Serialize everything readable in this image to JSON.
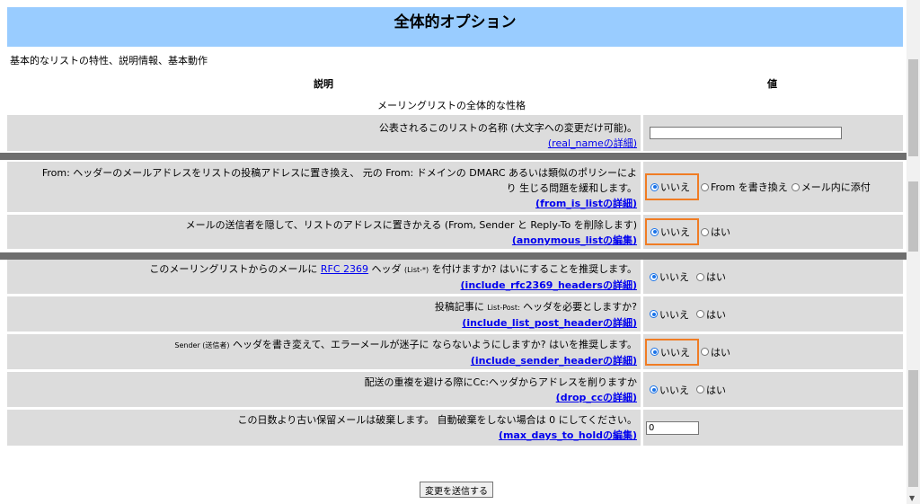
{
  "header": {
    "title": "全体的オプション"
  },
  "subtitle": "基本的なリストの特性、説明情報、基本動作",
  "columns": {
    "description": "説明",
    "value": "値"
  },
  "section_title": "メーリングリストの全体的な性格",
  "rows": [
    {
      "text": "公表されるこのリストの名称 (大文字への変更だけ可能)。",
      "link": "(real_nameの詳細)",
      "input_value": ""
    },
    {
      "text1": "From: ヘッダーのメールアドレスをリストの投稿アドレスに置き換え、 元の From: ドメインの DMARC あるいは類似のポリシーによ",
      "text2": "り 生じる問題を緩和します。",
      "link": "(from_is_listの詳細)",
      "options": [
        "いいえ",
        "From を書き換え",
        "メール内に添付"
      ]
    },
    {
      "text": "メールの送信者を隠して、リストのアドレスに置きかえる (From, Sender と Reply-To を削除します)",
      "link": "(anonymous_listの編集)",
      "options": [
        "いいえ",
        "はい"
      ]
    },
    {
      "text_pre": "このメーリングリストからのメールに ",
      "rfc": "RFC 2369",
      "text_post": " ヘッダ",
      "small": "(List-*)",
      "text_end": " を付けますか? はいにすることを推奨します。",
      "link": "(include_rfc2369_headersの詳細)",
      "options": [
        "いいえ",
        "はい"
      ]
    },
    {
      "text_pre": "投稿記事に ",
      "small": "List-Post:",
      "text_post": " ヘッダを必要としますか?",
      "link": "(include_list_post_headerの詳細)",
      "options": [
        "いいえ",
        "はい"
      ]
    },
    {
      "small": "Sender (送信者)",
      "text": " ヘッダを書き変えて、エラーメールが迷子に ならないようにしますか? はいを推奨します。",
      "link": "(include_sender_headerの詳細)",
      "options": [
        "いいえ",
        "はい"
      ]
    },
    {
      "text": "配送の重複を避ける際にCc:ヘッダからアドレスを削りますか",
      "link": "(drop_ccの詳細)",
      "options": [
        "いいえ",
        "はい"
      ]
    },
    {
      "text": "この日数より古い保留メールは破棄します。 自動破棄をしない場合は 0 にしてください。",
      "link": "(max_days_to_holdの編集)",
      "input_value": "0"
    }
  ],
  "submit_label": "変更を送信する",
  "colors": {
    "header_band": "#99ccff",
    "row_bg": "#dcdcdc",
    "highlight": "#f07c24",
    "divider": "#6e6e6e"
  }
}
